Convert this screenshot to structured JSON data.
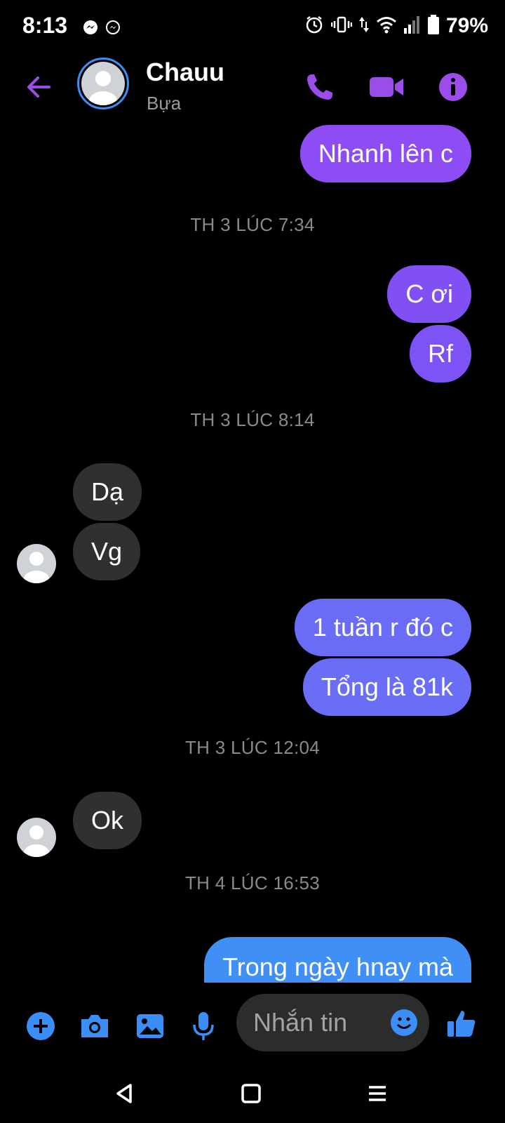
{
  "status_bar": {
    "time": "8:13",
    "battery": "79%"
  },
  "header": {
    "name": "Chauu",
    "subtitle": "Bựa"
  },
  "messages": [
    {
      "type": "out",
      "text": "Nhanh lên c",
      "color": "#8e4cf5"
    },
    {
      "type": "timestamp",
      "text": "TH 3 LÚC 7:34"
    },
    {
      "type": "out",
      "text": "C ơi",
      "color": "#8150f5"
    },
    {
      "type": "out",
      "text": "Rf",
      "color": "#7d53f5"
    },
    {
      "type": "timestamp",
      "text": "TH 3 LÚC 8:14"
    },
    {
      "type": "in",
      "text": "Dạ"
    },
    {
      "type": "in",
      "text": "Vg"
    },
    {
      "type": "out",
      "text": "1 tuần r đó c",
      "color": "#6b6cf6"
    },
    {
      "type": "out",
      "text": "Tổng là 81k",
      "color": "#6a6ef6"
    },
    {
      "type": "timestamp",
      "text": "TH 3 LÚC 12:04"
    },
    {
      "type": "in",
      "text": "Ok"
    },
    {
      "type": "timestamp",
      "text": "TH 4 LÚC 16:53"
    },
    {
      "type": "out",
      "text": "Trong ngày hnay mà",
      "color": "#3f8ff4"
    }
  ],
  "composer": {
    "placeholder": "Nhắn tin"
  },
  "colors": {
    "accent_purple": "#9b4dea",
    "accent_blue": "#3b8ef5"
  }
}
